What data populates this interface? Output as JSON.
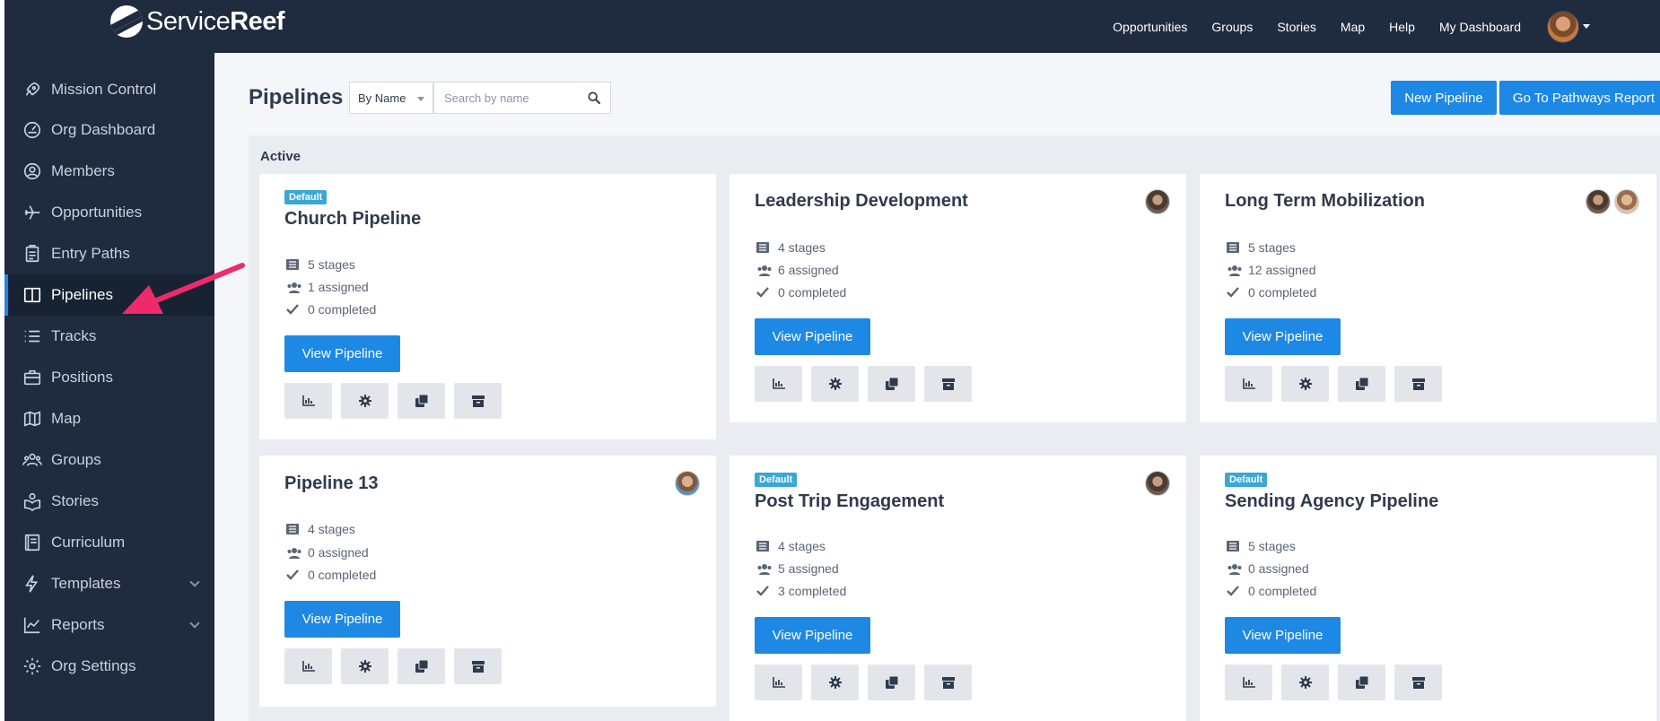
{
  "brand": {
    "name_light": "Service",
    "name_bold": "Reef"
  },
  "topnav": {
    "links": [
      "Opportunities",
      "Groups",
      "Stories",
      "Map",
      "Help",
      "My Dashboard"
    ]
  },
  "sidebar": {
    "items": [
      {
        "label": "Mission Control",
        "icon": "rocket-icon"
      },
      {
        "label": "Org Dashboard",
        "icon": "gauge-icon"
      },
      {
        "label": "Members",
        "icon": "user-circle-icon"
      },
      {
        "label": "Opportunities",
        "icon": "plane-icon"
      },
      {
        "label": "Entry Paths",
        "icon": "clipboard-icon"
      },
      {
        "label": "Pipelines",
        "icon": "columns-icon",
        "active": true
      },
      {
        "label": "Tracks",
        "icon": "list-icon"
      },
      {
        "label": "Positions",
        "icon": "briefcase-icon"
      },
      {
        "label": "Map",
        "icon": "map-icon"
      },
      {
        "label": "Groups",
        "icon": "users-icon"
      },
      {
        "label": "Stories",
        "icon": "book-open-icon"
      },
      {
        "label": "Curriculum",
        "icon": "book-icon"
      },
      {
        "label": "Templates",
        "icon": "bolt-icon",
        "expandable": true
      },
      {
        "label": "Reports",
        "icon": "line-chart-icon",
        "expandable": true
      },
      {
        "label": "Org Settings",
        "icon": "gear-icon"
      }
    ]
  },
  "main": {
    "title": "Pipelines",
    "sort_select": "By Name",
    "search_placeholder": "Search by name",
    "new_pipeline_label": "New Pipeline",
    "pathways_report_label": "Go To Pathways Report",
    "section_title": "Active",
    "view_label": "View Pipeline",
    "badge_label": "Default",
    "cards": [
      {
        "title": "Church Pipeline",
        "default": true,
        "stages": "5 stages",
        "assigned": "1 assigned",
        "completed": "0 completed"
      },
      {
        "title": "Leadership Development",
        "default": false,
        "stages": "4 stages",
        "assigned": "6 assigned",
        "completed": "0 completed"
      },
      {
        "title": "Long Term Mobilization",
        "default": false,
        "stages": "5 stages",
        "assigned": "12 assigned",
        "completed": "0 completed"
      },
      {
        "title": "Pipeline 13",
        "default": false,
        "stages": "4 stages",
        "assigned": "0 assigned",
        "completed": "0 completed"
      },
      {
        "title": "Post Trip Engagement",
        "default": true,
        "stages": "4 stages",
        "assigned": "5 assigned",
        "completed": "3 completed"
      },
      {
        "title": "Sending Agency Pipeline",
        "default": true,
        "stages": "5 stages",
        "assigned": "0 assigned",
        "completed": "0 completed"
      }
    ]
  },
  "colors": {
    "sidebar_bg": "#1f2b3e",
    "accent": "#1e88e5",
    "badge": "#3aa7d6",
    "annotation_arrow": "#ee2a6b"
  }
}
